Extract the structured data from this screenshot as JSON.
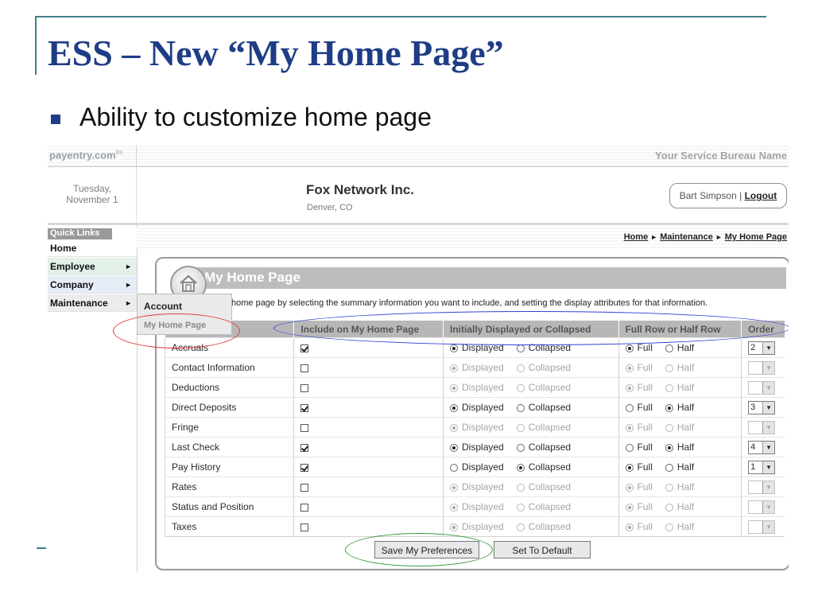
{
  "slide": {
    "title": "ESS – New “My Home Page”",
    "bullet": "Ability to customize home page"
  },
  "app": {
    "brand": "payentry.com",
    "brand_mark": "tm",
    "bureau": "Your Service Bureau Name",
    "date_line1": "Tuesday,",
    "date_line2": "November 1",
    "company": "Fox Network Inc.",
    "location": "Denver, CO",
    "user": "Bart Simpson",
    "user_sep": "|",
    "logout": "Logout"
  },
  "sidebar": {
    "label": "Quick Links",
    "items": [
      {
        "label": "Home"
      },
      {
        "label": "Employee",
        "arrow": "►"
      },
      {
        "label": "Company",
        "arrow": "►"
      },
      {
        "label": "Maintenance",
        "arrow": "►"
      }
    ],
    "submenu": [
      "Account",
      "My Home Page"
    ]
  },
  "breadcrumb": {
    "items": [
      "Home",
      "Maintenance",
      "My Home Page"
    ],
    "sep": "►"
  },
  "panel": {
    "title": "My Home Page",
    "intro": "home page by selecting the summary information you want to include, and setting the display attributes for that information."
  },
  "table": {
    "headers": [
      "rmation",
      "Include on My Home Page",
      "Initially Displayed or Collapsed",
      "Full Row or Half Row",
      "Order"
    ],
    "labels": {
      "displayed": "Displayed",
      "collapsed": "Collapsed",
      "full": "Full",
      "half": "Half"
    },
    "rows": [
      {
        "name": "Accruals",
        "include": true,
        "display": "Displayed",
        "width": "Full",
        "order": "2"
      },
      {
        "name": "Contact Information",
        "include": false,
        "display": "Displayed",
        "width": "Full",
        "order": ""
      },
      {
        "name": "Deductions",
        "include": false,
        "display": "Displayed",
        "width": "Full",
        "order": ""
      },
      {
        "name": "Direct Deposits",
        "include": true,
        "display": "Displayed",
        "width": "Half",
        "order": "3"
      },
      {
        "name": "Fringe",
        "include": false,
        "display": "Displayed",
        "width": "Full",
        "order": ""
      },
      {
        "name": "Last Check",
        "include": true,
        "display": "Displayed",
        "width": "Half",
        "order": "4"
      },
      {
        "name": "Pay History",
        "include": true,
        "display": "Collapsed",
        "width": "Full",
        "order": "1"
      },
      {
        "name": "Rates",
        "include": false,
        "display": "Displayed",
        "width": "Full",
        "order": ""
      },
      {
        "name": "Status and Position",
        "include": false,
        "display": "Displayed",
        "width": "Full",
        "order": ""
      },
      {
        "name": "Taxes",
        "include": false,
        "display": "Displayed",
        "width": "Full",
        "order": ""
      }
    ]
  },
  "buttons": {
    "save": "Save My Preferences",
    "default": "Set To Default"
  },
  "colors": {
    "slide_title": "#1f3d86",
    "highlight_red": "#e23a3a",
    "highlight_blue": "#2f3fd4",
    "highlight_green": "#3a9a3a"
  }
}
